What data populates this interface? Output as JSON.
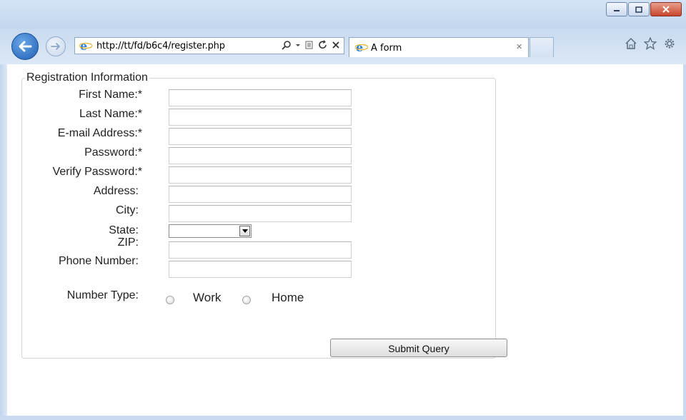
{
  "window": {
    "controls": [
      "minimize-icon",
      "maximize-icon",
      "close-icon"
    ]
  },
  "navigation": {
    "url": "http://tt/fd/b6c4/register.php",
    "tab_title": "A form",
    "tab_close": "×"
  },
  "form": {
    "legend": "Registration Information",
    "fields": [
      {
        "label": "First Name:*",
        "value": ""
      },
      {
        "label": "Last Name:*",
        "value": ""
      },
      {
        "label": "E-mail Address:*",
        "value": ""
      },
      {
        "label": "Password:*",
        "value": ""
      },
      {
        "label": "Verify Password:*",
        "value": ""
      },
      {
        "label": "Address:",
        "value": ""
      },
      {
        "label": "City:",
        "value": ""
      }
    ],
    "state_label": "State:",
    "state_value": "",
    "zip_label": "ZIP:",
    "zip_value": "",
    "phone_label": "Phone Number:",
    "phone_value": "",
    "number_type_label": "Number Type:",
    "radio_options": [
      "Work",
      "Home"
    ],
    "submit_label": "Submit Query"
  },
  "colors": {
    "frame": "#d8e6f5",
    "back_button": "#1f5fb4",
    "close_button": "#c8452c"
  }
}
